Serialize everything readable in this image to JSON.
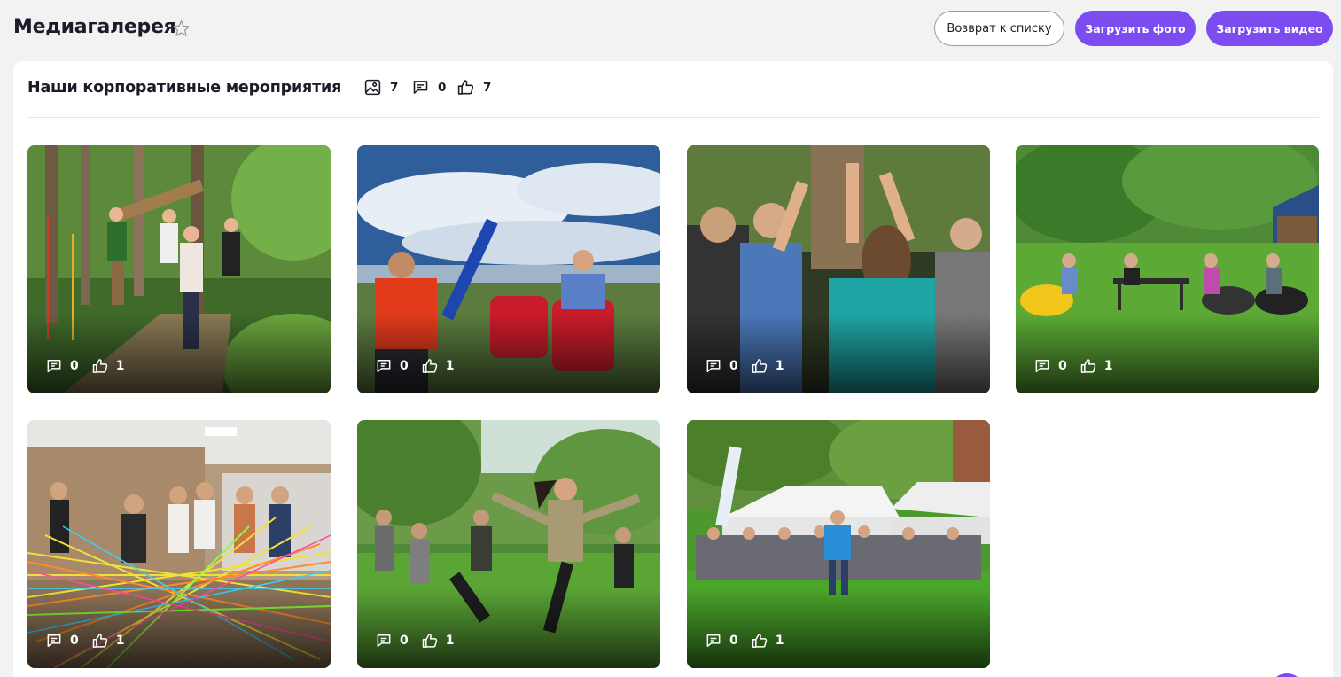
{
  "header": {
    "title": "Медиагалерея",
    "back_label": "Возврат к списку",
    "upload_photo_label": "Загрузить фото",
    "upload_video_label": "Загрузить видео"
  },
  "album": {
    "title": "Наши корпоративные мероприятия",
    "photos_count": "7",
    "comments_count": "0",
    "likes_count": "7"
  },
  "photos": [
    {
      "comments": "0",
      "likes": "1",
      "scene": "forest-run"
    },
    {
      "comments": "0",
      "likes": "1",
      "scene": "beach-foam-fight"
    },
    {
      "comments": "0",
      "likes": "1",
      "scene": "high-five"
    },
    {
      "comments": "0",
      "likes": "1",
      "scene": "lawn-bean-bags"
    },
    {
      "comments": "0",
      "likes": "1",
      "scene": "indoor-yarn-web"
    },
    {
      "comments": "0",
      "likes": "1",
      "scene": "forest-dance"
    },
    {
      "comments": "0",
      "likes": "1",
      "scene": "group-tents"
    }
  ],
  "colors": {
    "accent": "#7d4cf0",
    "background": "#f2f2f3",
    "card": "#ffffff"
  }
}
